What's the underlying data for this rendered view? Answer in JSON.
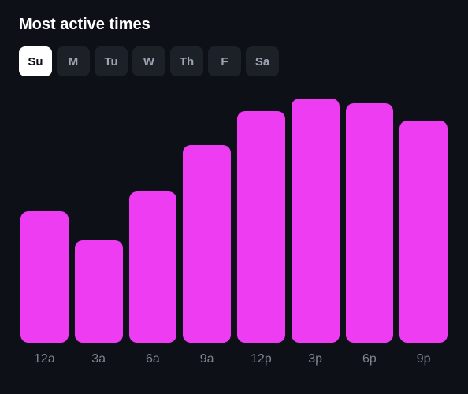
{
  "title": "Most active times",
  "days": {
    "items": [
      {
        "label": "Su",
        "active": true
      },
      {
        "label": "M",
        "active": false
      },
      {
        "label": "Tu",
        "active": false
      },
      {
        "label": "W",
        "active": false
      },
      {
        "label": "Th",
        "active": false
      },
      {
        "label": "F",
        "active": false
      },
      {
        "label": "Sa",
        "active": false
      }
    ]
  },
  "chart_data": {
    "type": "bar",
    "title": "Most active times",
    "xlabel": "",
    "ylabel": "",
    "ylim": [
      0,
      100
    ],
    "categories": [
      "12a",
      "3a",
      "6a",
      "9a",
      "12p",
      "3p",
      "6p",
      "9p"
    ],
    "values": [
      54,
      42,
      62,
      81,
      95,
      100,
      98,
      91
    ],
    "color": "#ee3cf2"
  }
}
